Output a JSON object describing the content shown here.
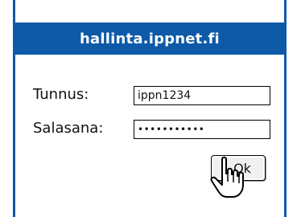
{
  "header": {
    "title": "hallinta.ippnet.fi"
  },
  "form": {
    "username_label": "Tunnus:",
    "username_value": "ippn1234",
    "password_label": "Salasana:",
    "password_value": "•••••••••••"
  },
  "actions": {
    "ok_label": "Ok"
  },
  "colors": {
    "accent": "#0e5aa8",
    "header_text": "#ffffff"
  },
  "icons": {
    "cursor": "hand-pointer-icon"
  }
}
